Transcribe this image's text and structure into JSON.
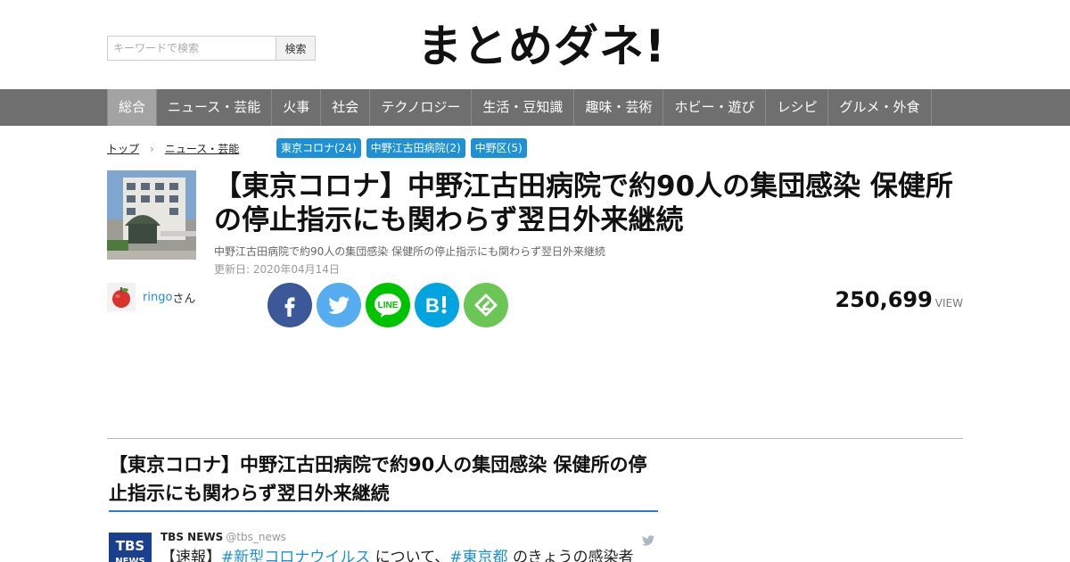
{
  "search": {
    "placeholder": "キーワードで検索",
    "button": "検索"
  },
  "site": {
    "logo": "まとめダネ!"
  },
  "nav": {
    "items": [
      "総合",
      "ニュース・芸能",
      "火事",
      "社会",
      "テクノロジー",
      "生活・豆知識",
      "趣味・芸術",
      "ホビー・遊び",
      "レシピ",
      "グルメ・外食"
    ],
    "active": 0
  },
  "breadcrumb": {
    "home": "トップ",
    "sep": "›",
    "category": "ニュース・芸能"
  },
  "tags": [
    "東京コロナ(24)",
    "中野江古田病院(2)",
    "中野区(5)"
  ],
  "article": {
    "title": "【東京コロナ】中野江古田病院で約90人の集団感染 保健所の停止指示にも関わらず翌日外来継続",
    "description": "中野江古田病院で約90人の集団感染 保健所の停止指示にも関わらず翌日外来継続",
    "updated": "更新日: 2020年04月14日",
    "author": "ringo",
    "author_suffix": "さん",
    "views": "250,699",
    "views_label": "VIEW"
  },
  "share": [
    {
      "name": "facebook-icon",
      "color": "#3b5998"
    },
    {
      "name": "twitter-icon",
      "color": "#55acee"
    },
    {
      "name": "line-icon",
      "color": "#00c300"
    },
    {
      "name": "hatena-bookmark-icon",
      "color": "#00a4de"
    },
    {
      "name": "feedly-icon",
      "color": "#6cc655"
    }
  ],
  "section": {
    "heading": "【東京コロナ】中野江古田病院で約90人の集団感染 保健所の停止指示にも関わらず翌日外来継続"
  },
  "tweet": {
    "avatar_line1": "TBS",
    "avatar_line2": "NEWS",
    "name": "TBS NEWS",
    "handle": "@tbs_news",
    "body_prefix": "【速報】",
    "hashtag1": "#新型コロナウイルス",
    "body_mid": " について、",
    "hashtag2": "#東京都",
    "body_suffix": " のきょうの感染者"
  }
}
